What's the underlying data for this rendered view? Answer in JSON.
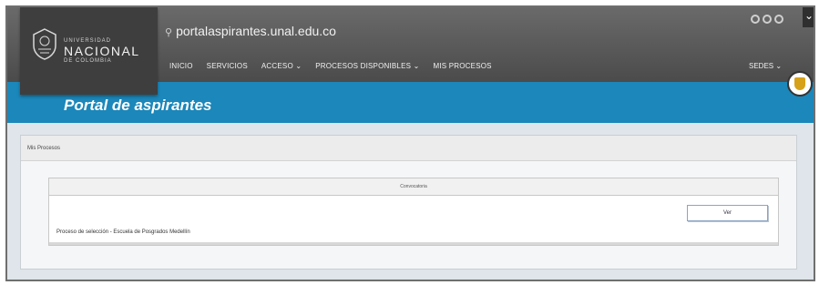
{
  "header": {
    "university_small": "UNIVERSIDAD",
    "university_big": "NACIONAL",
    "university_sub": "DE COLOMBIA",
    "site_url": "portalaspirantes.unal.edu.co",
    "nav": [
      "INICIO",
      "SERVICIOS",
      "ACCESO",
      "PROCESOS DISPONIBLES",
      "MIS PROCESOS"
    ],
    "sedes": "SEDES"
  },
  "page": {
    "title": "Portal de aspirantes",
    "card_title": "Mis Procesos",
    "panel_header": "Convocatoria",
    "row_label": "Proceso de selección - Escuela de Posgrados Medellín",
    "view_button": "Ver"
  }
}
